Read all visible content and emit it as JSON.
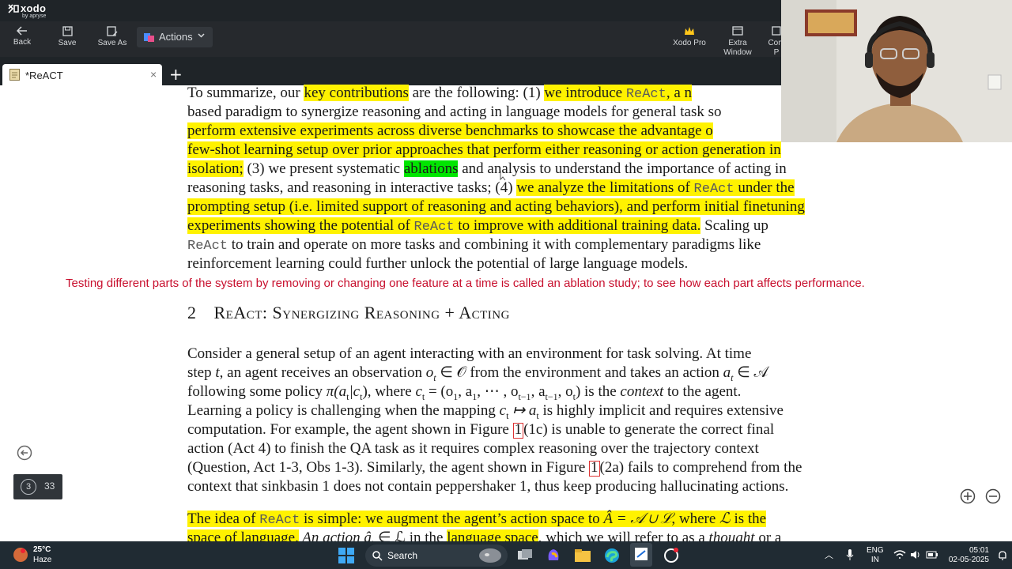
{
  "app": {
    "name": "xodo",
    "by": "by apryse"
  },
  "toolbar": {
    "back": "Back",
    "save": "Save",
    "save_as": "Save As",
    "actions": "Actions",
    "xodo_pro": "Xodo Pro",
    "extra_window_1": "Extra",
    "extra_window_2": "Window",
    "compact_1": "Com",
    "compact_2": "P"
  },
  "tab": {
    "title": "*ReACT",
    "new_tab": "+"
  },
  "document": {
    "l1": {
      "a": "To summarize, our ",
      "b": "key contributions",
      "c": " are the following: (1) ",
      "d": "we introduce ",
      "e": "ReAct",
      "f": ", a n"
    },
    "l2": "based paradigm to synergize reasoning and acting in language models for general task so",
    "l3": "perform extensive experiments across diverse benchmarks to showcase the advantage o",
    "l4": "few-shot learning setup over prior approaches that perform either reasoning or action generation in",
    "l5": {
      "a": "isolation;",
      "b": " (3) we present systematic ",
      "c": "ablations",
      "d": " and analysis to understand the importance of acting in"
    },
    "l6": {
      "a": "reasoning tasks, and reasoning in interactive tasks; (4) ",
      "b": "we analyze the limitations of ",
      "c": "ReAct",
      "d": " under the"
    },
    "l7": "prompting setup (i.e. limited support of reasoning and acting behaviors), and perform initial finetuning",
    "l8": {
      "a": "experiments showing the potential of ",
      "b": "ReAct",
      "c": " to improve with additional training data.",
      "d": " Scaling up"
    },
    "l9": {
      "a": "ReAct",
      "b": " to train and operate on more tasks and combining it with complementary paradigms like"
    },
    "l10": "reinforcement learning could further unlock the potential of large language models.",
    "annotation": "Testing different parts of the system by removing or changing one feature at a time is called an ablation study; to see how each part affects performance.",
    "section_num": "2",
    "section_title": "ReAct: Synergizing Reasoning + Acting",
    "p1": "Consider a general setup of an agent interacting with an environment for task solving.  At time",
    "p2a": "step ",
    "p2b": "t",
    "p2c": ", an agent receives an observation ",
    "p2d": "o",
    "p2e": "t",
    "p2f": " ∈ 𝒪 from the environment and takes an action ",
    "p2g": "a",
    "p2h": "t",
    "p2i": " ∈ 𝒜",
    "p3a": "following some policy ",
    "p3b": "π(a",
    "p3c": "t",
    "p3d": "|c",
    "p3e": "t",
    "p3f": "), where ",
    "p3g": "c",
    "p3h": "t",
    "p3i": " = (o",
    "p3j": "1",
    "p3k": ", a",
    "p3l": "1",
    "p3m": ", ⋯ , o",
    "p3n": "t−1",
    "p3o": ", a",
    "p3p": "t−1",
    "p3q": ", o",
    "p3r": "t",
    "p3s": ") is the ",
    "p3t": "context",
    "p3u": " to the agent.",
    "p4a": "Learning a policy is challenging when the mapping ",
    "p4b": "c",
    "p4c": "t",
    "p4d": " ↦ a",
    "p4e": "t",
    "p4f": " is highly implicit and requires extensive",
    "p5a": "computation. For example, the agent shown in Figure ",
    "p5b": "1",
    "p5c": "(1c) is unable to generate the correct final",
    "p6": "action (Act 4) to finish the QA task as it requires complex reasoning over the trajectory context",
    "p7a": "(Question, Act 1-3, Obs 1-3). Similarly, the agent shown in Figure ",
    "p7b": "1",
    "p7c": "(2a) fails to comprehend from the",
    "p8": "context that sinkbasin 1 does not contain peppershaker 1, thus keep producing hallucinating actions.",
    "p9a": "The idea of ",
    "p9b": "ReAct",
    "p9c": " is simple: we augment the agent’s action space to ",
    "p9d": "Â = 𝒜 ∪ ℒ",
    "p9e": ", where ",
    "p9f": "ℒ",
    "p9g": " is the",
    "p10a": "space of language.",
    "p10b": " An action â",
    "p10c": "t",
    "p10d": " ∈ ℒ in the ",
    "p10e": "language space",
    "p10f": ", which we will refer to as a ",
    "p10g": "thought",
    "p10h": " or a"
  },
  "pager": {
    "current": "3",
    "total": "33"
  },
  "taskbar": {
    "temp": "25°C",
    "weather": "Haze",
    "search": "Search",
    "lang1": "ENG",
    "lang2": "IN",
    "time": "05:01",
    "date": "02-05-2025"
  },
  "colors": {
    "highlight_yellow": "#fff200",
    "highlight_green": "#00e600",
    "annotation_red": "#c8102e",
    "chrome_dark": "#26292d"
  }
}
